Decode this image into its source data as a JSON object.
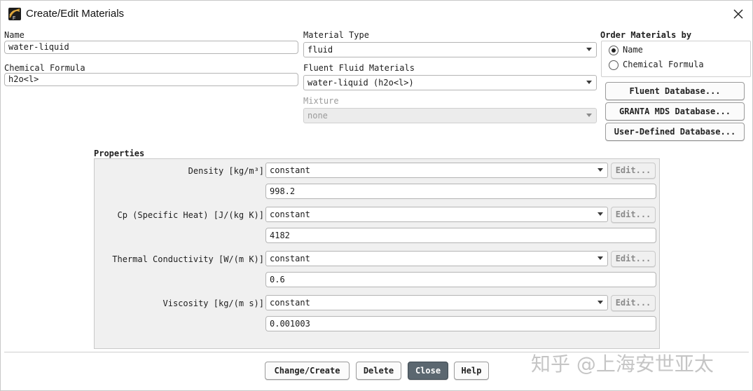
{
  "window": {
    "title": "Create/Edit Materials"
  },
  "name_field": {
    "label": "Name",
    "value": "water-liquid"
  },
  "formula_field": {
    "label": "Chemical Formula",
    "value": "h2o<l>"
  },
  "material_type": {
    "label": "Material Type",
    "value": "fluid"
  },
  "fluent_materials": {
    "label": "Fluent Fluid Materials",
    "value": "water-liquid (h2o<l>)"
  },
  "mixture": {
    "label": "Mixture",
    "value": "none"
  },
  "order_by": {
    "label": "Order Materials by",
    "options": [
      {
        "label": "Name",
        "selected": true
      },
      {
        "label": "Chemical Formula",
        "selected": false
      }
    ]
  },
  "db_buttons": {
    "fluent": "Fluent Database...",
    "granta": "GRANTA MDS Database...",
    "user": "User-Defined Database..."
  },
  "properties": {
    "title": "Properties",
    "edit_label": "Edit...",
    "rows": [
      {
        "label": "Density [kg/m³]",
        "method": "constant",
        "value": "998.2"
      },
      {
        "label": "Cp (Specific Heat) [J/(kg K)]",
        "method": "constant",
        "value": "4182"
      },
      {
        "label": "Thermal Conductivity [W/(m K)]",
        "method": "constant",
        "value": "0.6"
      },
      {
        "label": "Viscosity [kg/(m s)]",
        "method": "constant",
        "value": "0.001003"
      }
    ]
  },
  "footer": {
    "change_create": "Change/Create",
    "delete": "Delete",
    "close": "Close",
    "help": "Help"
  },
  "watermark": "知乎 @上海安世亚太",
  "colors": {
    "primary_button": "#5b6770",
    "panel_bg": "#f0f0f0"
  }
}
